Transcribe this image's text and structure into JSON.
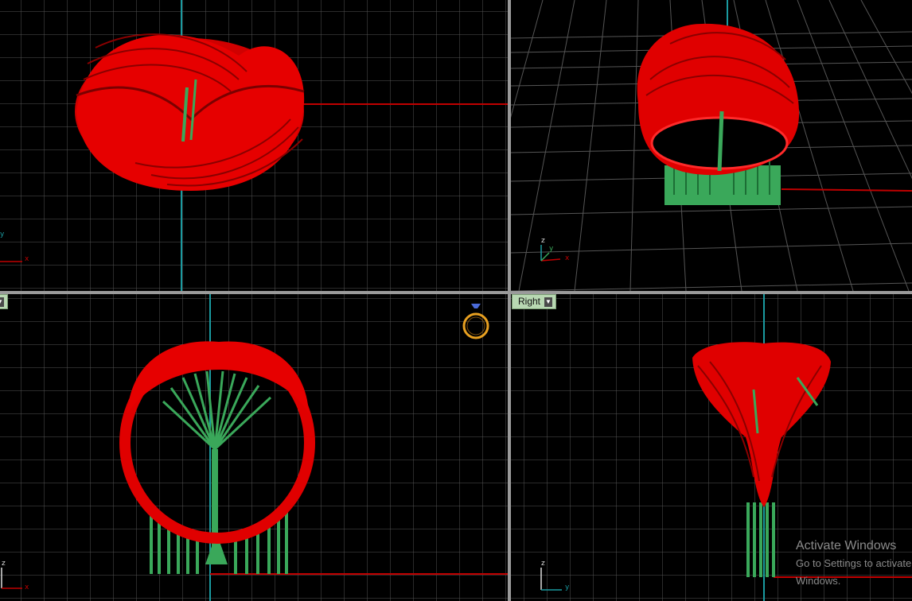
{
  "viewports": {
    "top": {
      "axes": {
        "x": "x",
        "y": "y"
      }
    },
    "perspective": {
      "axes": {
        "x": "x",
        "y": "y",
        "z": "z"
      }
    },
    "front": {
      "axes": {
        "x": "x",
        "z": "z"
      }
    },
    "right": {
      "label": "Right",
      "axes": {
        "y": "y",
        "z": "z"
      }
    }
  },
  "watermark": {
    "line1": "Activate Windows",
    "line2": "Go to Settings to activate Windows."
  },
  "colors": {
    "background": "#000000",
    "grid": "#5a5a5a",
    "grid_major": "#8a8a8a",
    "axis_x": "#c00000",
    "axis_y": "#1a9aa0",
    "model": "#e00000",
    "supports": "#3aa85a",
    "accent_icon": "#e8a020"
  },
  "icons": [
    "dropdown-arrow-icon",
    "ring-diamond-icon",
    "axis-gizmo-icon"
  ]
}
